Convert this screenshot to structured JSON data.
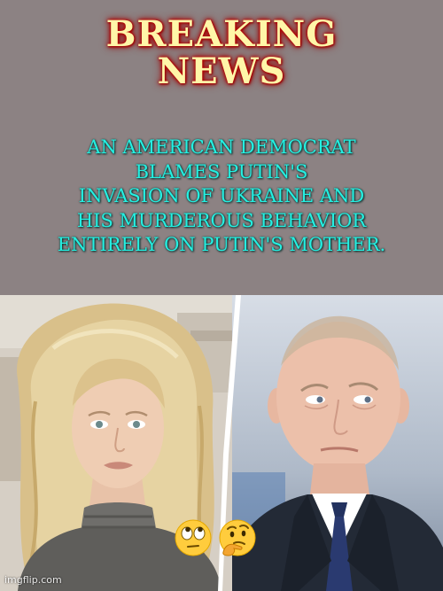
{
  "meme": {
    "headline_lines": [
      "BREAKING",
      "NEWS"
    ],
    "subtext_lines": [
      "AN AMERICAN DEMOCRAT",
      "BLAMES PUTIN'S",
      "INVASION OF UKRAINE AND",
      "HIS MURDEROUS BEHAVIOR",
      "ENTIRELY ON PUTIN'S MOTHER."
    ],
    "reactions": [
      "🙄",
      "🤔"
    ],
    "reaction_icons": [
      "face-with-rolling-eyes-icon",
      "thinking-face-icon"
    ],
    "watermark": "imgflip.com"
  },
  "colors": {
    "top_background": "#8c8283",
    "headline_text": "#fff6a8",
    "headline_glow": "#c00000",
    "subtext": "#25f0e2"
  }
}
